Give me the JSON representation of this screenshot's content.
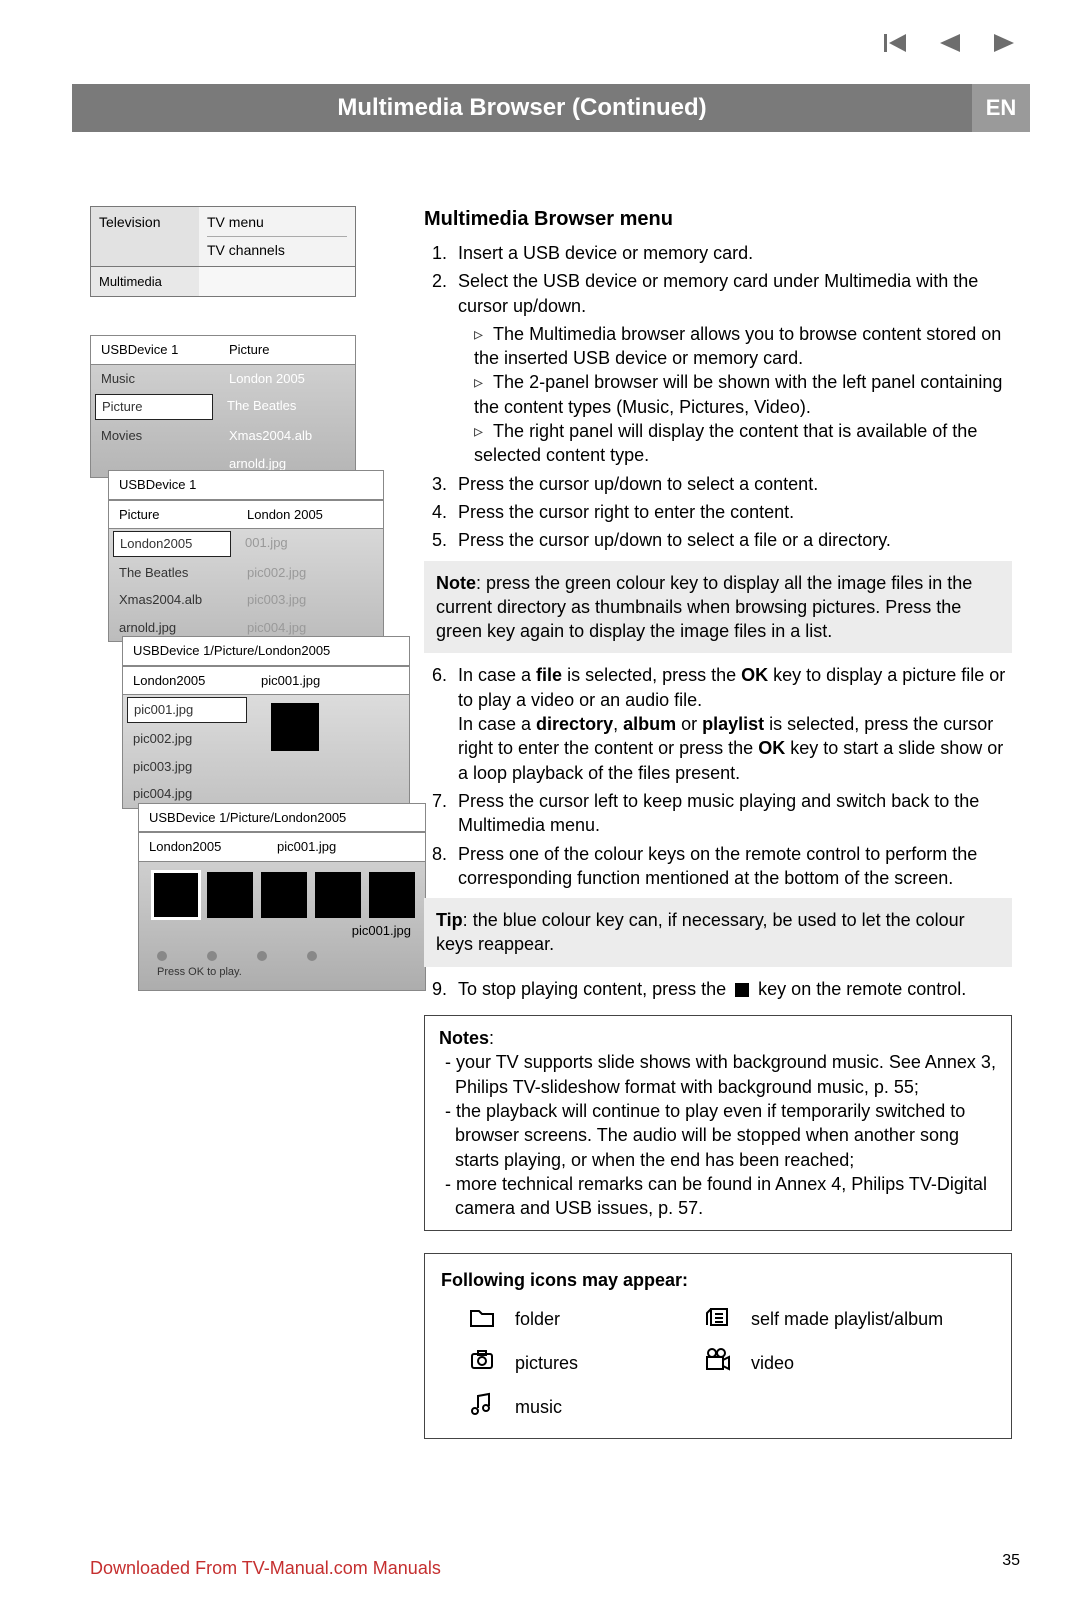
{
  "header": {
    "title": "Multimedia Browser  (Continued)",
    "lang": "EN"
  },
  "nav": {
    "prev_track": "|◀",
    "prev": "◀",
    "next": "▶"
  },
  "shot1": {
    "tv_label": "Television",
    "menu1": "TV menu",
    "menu2": "TV channels",
    "mm_label": "Multimedia"
  },
  "shot2": {
    "head_l": "USBDevice 1",
    "head_r": "Picture",
    "rows": [
      {
        "l": "Music",
        "r": "London 2005"
      },
      {
        "l": "Picture",
        "r": "The Beatles"
      },
      {
        "l": "Movies",
        "r": "Xmas2004.alb"
      },
      {
        "l": "",
        "r": "arnold.jpg"
      }
    ],
    "selected_index": 1
  },
  "shot3a": {
    "head_full": "USBDevice 1",
    "crumb_l": "Picture",
    "crumb_r": "London 2005",
    "rows": [
      {
        "l": "London2005",
        "r": "001.jpg"
      },
      {
        "l": "The Beatles",
        "r": "pic002.jpg"
      },
      {
        "l": "Xmas2004.alb",
        "r": "pic003.jpg"
      },
      {
        "l": "arnold.jpg",
        "r": "pic004.jpg"
      }
    ],
    "selected_index": 0
  },
  "shot3b": {
    "head_full": "USBDevice 1/Picture/London2005",
    "crumb_l": "London2005",
    "crumb_r": "pic001.jpg",
    "rows": [
      {
        "l": "pic001.jpg",
        "r": ""
      },
      {
        "l": "pic002.jpg",
        "r": ""
      },
      {
        "l": "pic003.jpg",
        "r": ""
      },
      {
        "l": "pic004.jpg",
        "r": ""
      }
    ],
    "selected_index": 0
  },
  "shot4": {
    "head_full": "USBDevice 1/Picture/London2005",
    "crumb_l": "London2005",
    "crumb_r": "pic001.jpg",
    "caption": "pic001.jpg",
    "hint": "Press OK to play."
  },
  "instructions": {
    "heading": "Multimedia Browser menu",
    "step1": "Insert a USB device or memory card.",
    "step2": "Select the USB device or memory card under Multimedia with the cursor up/down.",
    "step2_sub": [
      "The Multimedia browser allows you to browse content stored on the inserted USB device or memory card.",
      "The 2-panel browser will be shown with the left panel containing the content types (Music, Pictures, Video).",
      "The right panel will display the content that is available of the selected content type."
    ],
    "step3": "Press the cursor up/down to select a content.",
    "step4": "Press the cursor right to enter the content.",
    "step5": "Press the cursor up/down to select a file or a directory.",
    "note": "press the green colour key to display all the image files in the current directory as thumbnails when browsing pictures. Press the green key again to display the image files in a list.",
    "step6_a": "In case a ",
    "step6_b": " is selected, press the ",
    "step6_c": " key to display a picture file or to play a video or an audio file.",
    "step6_d": "In case a ",
    "step6_e": " is selected, press the cursor right to enter the content or press the ",
    "step6_f": " key to start a slide show or a loop playback of the files present.",
    "bold_file": "file",
    "bold_ok": "OK",
    "bold_dir": "directory",
    "bold_album": "album",
    "bold_playlist": "playlist",
    "step7": "Press the cursor left to keep music playing and switch back to the Multimedia menu.",
    "step8": "Press one of the colour keys on the remote control to perform the corresponding function mentioned at the bottom of the screen.",
    "tip": "the blue colour key can, if necessary, be used to let the colour keys reappear.",
    "step9_a": "To stop playing content, press the ",
    "step9_b": " key on the remote control.",
    "notes_heading": "Notes",
    "notes": [
      "your TV supports slide shows with background music. See Annex 3, Philips TV-slideshow format with background music, p. 55;",
      "the playback will continue to play even if temporarily switched to browser screens. The audio will be stopped when another song starts playing, or when the end has been reached;",
      "more technical remarks can be found in Annex 4, Philips TV-Digital camera and USB issues, p. 57."
    ]
  },
  "icons": {
    "heading": "Following icons may appear:",
    "folder": "folder",
    "pictures": "pictures",
    "music": "music",
    "playlist": "self made playlist/album",
    "video": "video"
  },
  "page_number": "35",
  "download_line": "Downloaded From TV-Manual.com Manuals"
}
